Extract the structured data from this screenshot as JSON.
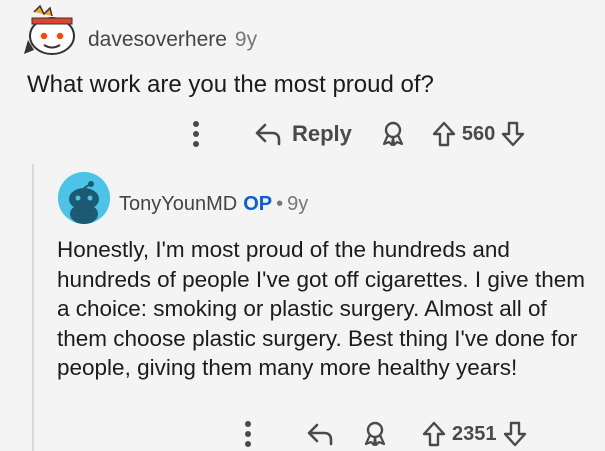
{
  "comment": {
    "author": "davesoverhere",
    "age": "9y",
    "text": "What work are you the most proud of?",
    "reply_label": "Reply",
    "score": "560"
  },
  "reply": {
    "author": "TonyYounMD",
    "op_badge": "OP",
    "separator": "•",
    "age": "9y",
    "text": "Honestly, I'm most proud of the hundreds and hundreds of people I've got off cigarettes. I give them a choice: smoking or plastic surgery. Almost all of them choose plastic surgery. Best thing I've done for people, giving them many more healthy years!",
    "score": "2351"
  },
  "icons": {
    "more": "more-options-icon",
    "reply": "reply-arrow-icon",
    "award": "award-icon",
    "upvote": "upvote-arrow-icon",
    "downvote": "downvote-arrow-icon"
  },
  "colors": {
    "background": "#f4f4f4",
    "op_badge": "#0a5fd6",
    "avatar_bg": "#4cc4e8",
    "text": "#1c1c1c",
    "meta": "#777777"
  }
}
